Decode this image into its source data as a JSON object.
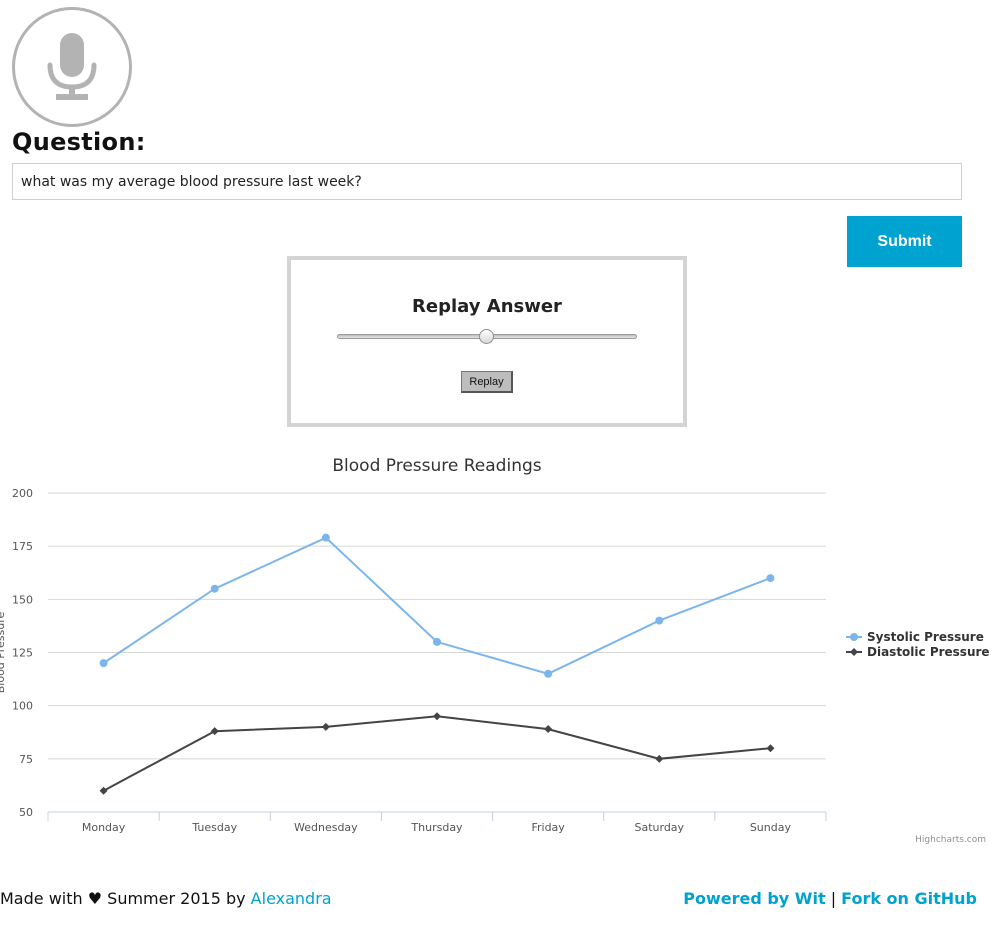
{
  "mic": {
    "icon": "microphone-icon"
  },
  "question": {
    "label": "Question:",
    "value": "what was my average blood pressure last week?"
  },
  "submit_label": "Submit",
  "replay": {
    "title": "Replay Answer",
    "progress": 0.5,
    "button_label": "Replay"
  },
  "chart_data": {
    "type": "line",
    "title": "Blood Pressure Readings",
    "ylabel": "Blood Pressure",
    "xlabel": "",
    "categories": [
      "Monday",
      "Tuesday",
      "Wednesday",
      "Thursday",
      "Friday",
      "Saturday",
      "Sunday"
    ],
    "ylim": [
      50,
      200
    ],
    "yticks": [
      50,
      75,
      100,
      125,
      150,
      175,
      200
    ],
    "grid": true,
    "legend_position": "right",
    "series": [
      {
        "name": "Systolic Pressure",
        "values": [
          120,
          155,
          179,
          130,
          115,
          140,
          160
        ],
        "color": "#7cb5ec",
        "marker": "circle"
      },
      {
        "name": "Diastolic Pressure",
        "values": [
          60,
          88,
          90,
          95,
          89,
          75,
          80
        ],
        "color": "#434348",
        "marker": "diamond"
      }
    ],
    "credits": "Highcharts.com"
  },
  "footer": {
    "made_with_prefix": "Made with",
    "heart": "♥",
    "made_with_suffix": "Summer 2015 by",
    "author": "Alexandra",
    "powered_by": "Powered by Wit",
    "separator": "|",
    "fork": "Fork on GitHub"
  },
  "colors": {
    "accent": "#00a2cf",
    "border": "#d4d4d4"
  }
}
